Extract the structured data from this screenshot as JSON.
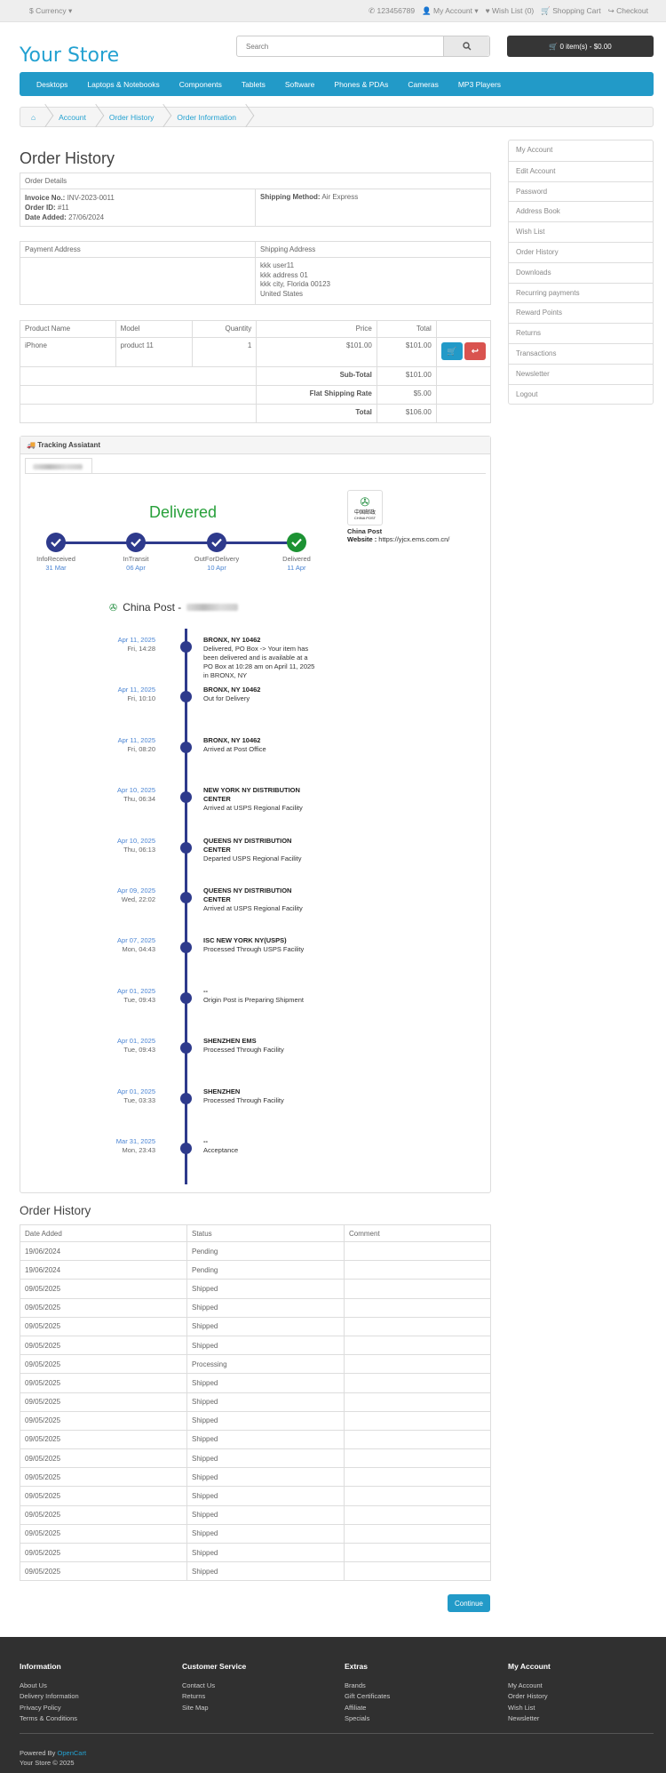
{
  "topbar": {
    "currency": "$ Currency",
    "phone": "123456789",
    "my_account": "My Account",
    "wishlist": "Wish List (0)",
    "shopping_cart": "Shopping Cart",
    "checkout": "Checkout"
  },
  "header": {
    "logo": "Your Store",
    "search_placeholder": "Search",
    "cart_label": "0 item(s) - $0.00"
  },
  "menu": [
    "Desktops",
    "Laptops & Notebooks",
    "Components",
    "Tablets",
    "Software",
    "Phones & PDAs",
    "Cameras",
    "MP3 Players"
  ],
  "breadcrumb": [
    "Account",
    "Order History",
    "Order Information"
  ],
  "page_title": "Order History",
  "order_details": {
    "heading": "Order Details",
    "invoice_label": "Invoice No.:",
    "invoice_value": "INV-2023-0011",
    "order_id_label": "Order ID:",
    "order_id_value": "#11",
    "date_label": "Date Added:",
    "date_value": "27/06/2024",
    "shipping_method_label": "Shipping Method:",
    "shipping_method_value": "Air Express"
  },
  "addresses": {
    "payment_heading": "Payment Address",
    "shipping_heading": "Shipping Address",
    "shipping_lines": [
      "kkk user11",
      "kkk address 01",
      "kkk city, Florida 00123",
      "United States"
    ]
  },
  "products": {
    "headers": [
      "Product Name",
      "Model",
      "Quantity",
      "Price",
      "Total"
    ],
    "row": {
      "name": "iPhone",
      "model": "product 11",
      "qty": "1",
      "price": "$101.00",
      "total": "$101.00"
    },
    "totals": [
      {
        "label": "Sub-Total",
        "value": "$101.00"
      },
      {
        "label": "Flat Shipping Rate",
        "value": "$5.00"
      },
      {
        "label": "Total",
        "value": "$106.00"
      }
    ]
  },
  "sidebar": [
    "My Account",
    "Edit Account",
    "Password",
    "Address Book",
    "Wish List",
    "Order History",
    "Downloads",
    "Recurring payments",
    "Reward Points",
    "Returns",
    "Transactions",
    "Newsletter",
    "Logout"
  ],
  "tracking": {
    "heading": "Tracking Assiatant",
    "status": "Delivered",
    "steps": [
      {
        "label": "InfoReceived",
        "date": "31 Mar"
      },
      {
        "label": "InTransit",
        "date": "06 Apr"
      },
      {
        "label": "OutForDelivery",
        "date": "10 Apr"
      },
      {
        "label": "Delivered",
        "date": "11 Apr"
      }
    ],
    "carrier_name": "China Post",
    "carrier_logo_text": "中国邮政",
    "carrier_logo_sub": "CHINA POST",
    "website_label": "Website :",
    "website_value": "https://yjcx.ems.com.cn/",
    "timeline_title": "China Post -",
    "events": [
      {
        "date": "Apr 11, 2025",
        "time": "Fri, 14:28",
        "loc": "BRONX, NY 10462",
        "desc": "Delivered, PO Box -> Your item has been delivered and is available at a PO Box at 10:28 am on April 11, 2025 in BRONX, NY"
      },
      {
        "date": "Apr 11, 2025",
        "time": "Fri, 10:10",
        "loc": "BRONX, NY 10462",
        "desc": "Out for Delivery"
      },
      {
        "date": "Apr 11, 2025",
        "time": "Fri, 08:20",
        "loc": "BRONX, NY 10462",
        "desc": "Arrived at Post Office"
      },
      {
        "date": "Apr 10, 2025",
        "time": "Thu, 06:34",
        "loc": "NEW YORK NY DISTRIBUTION CENTER",
        "desc": "Arrived at USPS Regional Facility"
      },
      {
        "date": "Apr 10, 2025",
        "time": "Thu, 06:13",
        "loc": "QUEENS NY DISTRIBUTION CENTER",
        "desc": "Departed USPS Regional Facility"
      },
      {
        "date": "Apr 09, 2025",
        "time": "Wed, 22:02",
        "loc": "QUEENS NY DISTRIBUTION CENTER",
        "desc": "Arrived at USPS Regional Facility"
      },
      {
        "date": "Apr 07, 2025",
        "time": "Mon, 04:43",
        "loc": "ISC NEW YORK NY(USPS)",
        "desc": "Processed Through USPS Facility"
      },
      {
        "date": "Apr 01, 2025",
        "time": "Tue, 09:43",
        "loc": "--",
        "desc": "Origin Post is Preparing Shipment"
      },
      {
        "date": "Apr 01, 2025",
        "time": "Tue, 09:43",
        "loc": "SHENZHEN EMS",
        "desc": "Processed Through Facility"
      },
      {
        "date": "Apr 01, 2025",
        "time": "Tue, 03:33",
        "loc": "SHENZHEN",
        "desc": "Processed Through Facility"
      },
      {
        "date": "Mar 31, 2025",
        "time": "Mon, 23:43",
        "loc": "--",
        "desc": "Acceptance"
      }
    ]
  },
  "history": {
    "title": "Order History",
    "headers": [
      "Date Added",
      "Status",
      "Comment"
    ],
    "rows": [
      [
        "19/06/2024",
        "Pending"
      ],
      [
        "19/06/2024",
        "Pending"
      ],
      [
        "09/05/2025",
        "Shipped"
      ],
      [
        "09/05/2025",
        "Shipped"
      ],
      [
        "09/05/2025",
        "Shipped"
      ],
      [
        "09/05/2025",
        "Shipped"
      ],
      [
        "09/05/2025",
        "Processing"
      ],
      [
        "09/05/2025",
        "Shipped"
      ],
      [
        "09/05/2025",
        "Shipped"
      ],
      [
        "09/05/2025",
        "Shipped"
      ],
      [
        "09/05/2025",
        "Shipped"
      ],
      [
        "09/05/2025",
        "Shipped"
      ],
      [
        "09/05/2025",
        "Shipped"
      ],
      [
        "09/05/2025",
        "Shipped"
      ],
      [
        "09/05/2025",
        "Shipped"
      ],
      [
        "09/05/2025",
        "Shipped"
      ],
      [
        "09/05/2025",
        "Shipped"
      ],
      [
        "09/05/2025",
        "Shipped"
      ]
    ],
    "continue_label": "Continue"
  },
  "footer": {
    "columns": [
      {
        "title": "Information",
        "links": [
          "About Us",
          "Delivery Information",
          "Privacy Policy",
          "Terms & Conditions"
        ]
      },
      {
        "title": "Customer Service",
        "links": [
          "Contact Us",
          "Returns",
          "Site Map"
        ]
      },
      {
        "title": "Extras",
        "links": [
          "Brands",
          "Gift Certificates",
          "Affiliate",
          "Specials"
        ]
      },
      {
        "title": "My Account",
        "links": [
          "My Account",
          "Order History",
          "Wish List",
          "Newsletter"
        ]
      }
    ],
    "powered_by": "Powered By",
    "powered_link": "OpenCart",
    "copyright": "Your Store © 2025"
  },
  "colors": {
    "accent": "#229ac8",
    "dark": "#303030",
    "track": "#2e3a8c",
    "success": "#1c9233",
    "danger": "#d9534f"
  }
}
